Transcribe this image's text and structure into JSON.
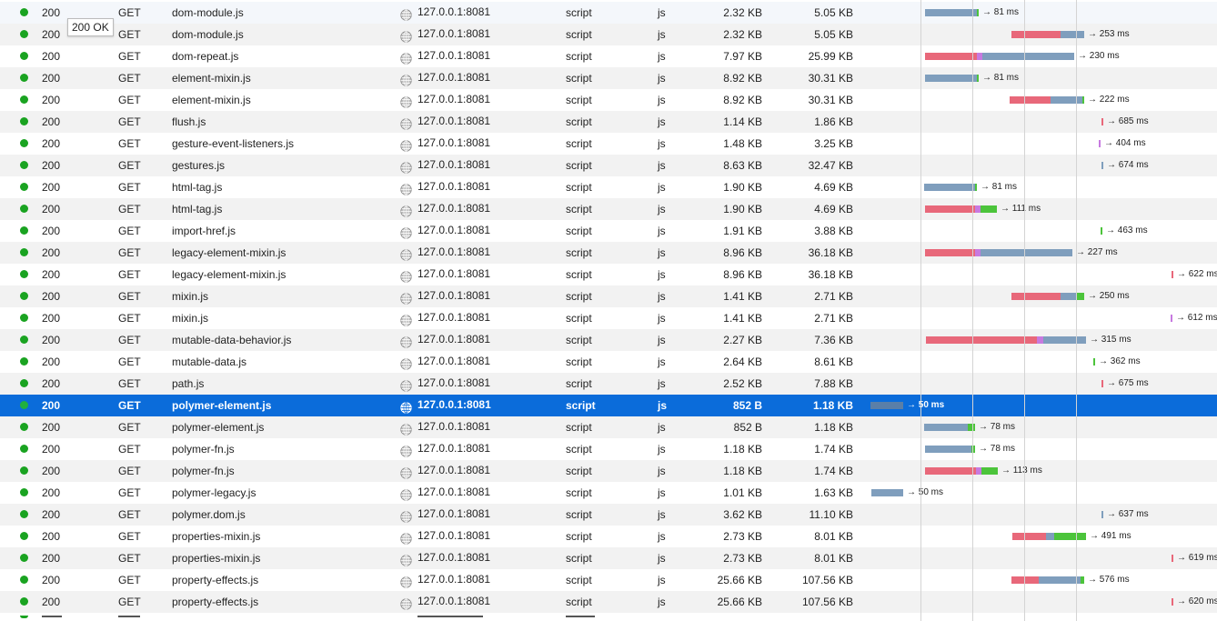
{
  "tooltip": "200 OK",
  "colors": {
    "blocked": "#e8687a",
    "dns": "#c77ae0",
    "wait": "#7f9ebd",
    "receive": "#4cc43b",
    "selected": "#0b6cda"
  },
  "rows": [
    {
      "status": "200",
      "method": "GET",
      "file": "dom-module.js",
      "domain": "127.0.0.1:8081",
      "type": "script",
      "ext": "js",
      "transferred": "2.32 KB",
      "size": "5.05 KB",
      "timing": "→ 81 ms",
      "segments": [
        {
          "s": 1017,
          "e": 1074,
          "c": "wait"
        },
        {
          "s": 1074,
          "e": 1076,
          "c": "receive"
        }
      ],
      "labelX": 1080
    },
    {
      "status": "200",
      "method": "GET",
      "file": "dom-module.js",
      "domain": "127.0.0.1:8081",
      "type": "script",
      "ext": "js",
      "transferred": "2.32 KB",
      "size": "5.05 KB",
      "timing": "→ 253 ms",
      "segments": [
        {
          "s": 1112,
          "e": 1166,
          "c": "blocked"
        },
        {
          "s": 1166,
          "e": 1192,
          "c": "wait"
        }
      ],
      "labelX": 1196
    },
    {
      "status": "200",
      "method": "GET",
      "file": "dom-repeat.js",
      "domain": "127.0.0.1:8081",
      "type": "script",
      "ext": "js",
      "transferred": "7.97 KB",
      "size": "25.99 KB",
      "timing": "→ 230 ms",
      "segments": [
        {
          "s": 1017,
          "e": 1074,
          "c": "blocked"
        },
        {
          "s": 1074,
          "e": 1080,
          "c": "dns"
        },
        {
          "s": 1080,
          "e": 1181,
          "c": "wait"
        }
      ],
      "labelX": 1185
    },
    {
      "status": "200",
      "method": "GET",
      "file": "element-mixin.js",
      "domain": "127.0.0.1:8081",
      "type": "script",
      "ext": "js",
      "transferred": "8.92 KB",
      "size": "30.31 KB",
      "timing": "→ 81 ms",
      "segments": [
        {
          "s": 1017,
          "e": 1074,
          "c": "wait"
        },
        {
          "s": 1074,
          "e": 1076,
          "c": "receive"
        }
      ],
      "labelX": 1080
    },
    {
      "status": "200",
      "method": "GET",
      "file": "element-mixin.js",
      "domain": "127.0.0.1:8081",
      "type": "script",
      "ext": "js",
      "transferred": "8.92 KB",
      "size": "30.31 KB",
      "timing": "→ 222 ms",
      "segments": [
        {
          "s": 1110,
          "e": 1155,
          "c": "blocked"
        },
        {
          "s": 1155,
          "e": 1190,
          "c": "wait"
        },
        {
          "s": 1190,
          "e": 1192,
          "c": "receive"
        }
      ],
      "labelX": 1196
    },
    {
      "status": "200",
      "method": "GET",
      "file": "flush.js",
      "domain": "127.0.0.1:8081",
      "type": "script",
      "ext": "js",
      "transferred": "1.14 KB",
      "size": "1.86 KB",
      "timing": "→ 685 ms",
      "segments": [
        {
          "s": 1211,
          "e": 1213,
          "c": "blocked"
        }
      ],
      "labelX": 1217
    },
    {
      "status": "200",
      "method": "GET",
      "file": "gesture-event-listeners.js",
      "domain": "127.0.0.1:8081",
      "type": "script",
      "ext": "js",
      "transferred": "1.48 KB",
      "size": "3.25 KB",
      "timing": "→ 404 ms",
      "segments": [
        {
          "s": 1208,
          "e": 1210,
          "c": "dns"
        }
      ],
      "labelX": 1214
    },
    {
      "status": "200",
      "method": "GET",
      "file": "gestures.js",
      "domain": "127.0.0.1:8081",
      "type": "script",
      "ext": "js",
      "transferred": "8.63 KB",
      "size": "32.47 KB",
      "timing": "→ 674 ms",
      "segments": [
        {
          "s": 1211,
          "e": 1213,
          "c": "wait"
        }
      ],
      "labelX": 1217
    },
    {
      "status": "200",
      "method": "GET",
      "file": "html-tag.js",
      "domain": "127.0.0.1:8081",
      "type": "script",
      "ext": "js",
      "transferred": "1.90 KB",
      "size": "4.69 KB",
      "timing": "→ 81 ms",
      "segments": [
        {
          "s": 1016,
          "e": 1072,
          "c": "wait"
        },
        {
          "s": 1072,
          "e": 1074,
          "c": "receive"
        }
      ],
      "labelX": 1078
    },
    {
      "status": "200",
      "method": "GET",
      "file": "html-tag.js",
      "domain": "127.0.0.1:8081",
      "type": "script",
      "ext": "js",
      "transferred": "1.90 KB",
      "size": "4.69 KB",
      "timing": "→ 111 ms",
      "segments": [
        {
          "s": 1017,
          "e": 1072,
          "c": "blocked"
        },
        {
          "s": 1072,
          "e": 1078,
          "c": "dns"
        },
        {
          "s": 1078,
          "e": 1096,
          "c": "receive"
        }
      ],
      "labelX": 1100
    },
    {
      "status": "200",
      "method": "GET",
      "file": "import-href.js",
      "domain": "127.0.0.1:8081",
      "type": "script",
      "ext": "js",
      "transferred": "1.91 KB",
      "size": "3.88 KB",
      "timing": "→ 463 ms",
      "segments": [
        {
          "s": 1210,
          "e": 1212,
          "c": "receive"
        }
      ],
      "labelX": 1216
    },
    {
      "status": "200",
      "method": "GET",
      "file": "legacy-element-mixin.js",
      "domain": "127.0.0.1:8081",
      "type": "script",
      "ext": "js",
      "transferred": "8.96 KB",
      "size": "36.18 KB",
      "timing": "→ 227 ms",
      "segments": [
        {
          "s": 1017,
          "e": 1072,
          "c": "blocked"
        },
        {
          "s": 1072,
          "e": 1078,
          "c": "dns"
        },
        {
          "s": 1078,
          "e": 1179,
          "c": "wait"
        }
      ],
      "labelX": 1183
    },
    {
      "status": "200",
      "method": "GET",
      "file": "legacy-element-mixin.js",
      "domain": "127.0.0.1:8081",
      "type": "script",
      "ext": "js",
      "transferred": "8.96 KB",
      "size": "36.18 KB",
      "timing": "→ 622 ms",
      "segments": [
        {
          "s": 1288,
          "e": 1290,
          "c": "blocked"
        }
      ],
      "labelX": 1294
    },
    {
      "status": "200",
      "method": "GET",
      "file": "mixin.js",
      "domain": "127.0.0.1:8081",
      "type": "script",
      "ext": "js",
      "transferred": "1.41 KB",
      "size": "2.71 KB",
      "timing": "→ 250 ms",
      "segments": [
        {
          "s": 1112,
          "e": 1166,
          "c": "blocked"
        },
        {
          "s": 1166,
          "e": 1183,
          "c": "wait"
        },
        {
          "s": 1183,
          "e": 1192,
          "c": "receive"
        }
      ],
      "labelX": 1196
    },
    {
      "status": "200",
      "method": "GET",
      "file": "mixin.js",
      "domain": "127.0.0.1:8081",
      "type": "script",
      "ext": "js",
      "transferred": "1.41 KB",
      "size": "2.71 KB",
      "timing": "→ 612 ms",
      "segments": [
        {
          "s": 1287,
          "e": 1289,
          "c": "dns"
        }
      ],
      "labelX": 1293
    },
    {
      "status": "200",
      "method": "GET",
      "file": "mutable-data-behavior.js",
      "domain": "127.0.0.1:8081",
      "type": "script",
      "ext": "js",
      "transferred": "2.27 KB",
      "size": "7.36 KB",
      "timing": "→ 315 ms",
      "segments": [
        {
          "s": 1018,
          "e": 1140,
          "c": "blocked"
        },
        {
          "s": 1140,
          "e": 1147,
          "c": "dns"
        },
        {
          "s": 1147,
          "e": 1194,
          "c": "wait"
        }
      ],
      "labelX": 1198
    },
    {
      "status": "200",
      "method": "GET",
      "file": "mutable-data.js",
      "domain": "127.0.0.1:8081",
      "type": "script",
      "ext": "js",
      "transferred": "2.64 KB",
      "size": "8.61 KB",
      "timing": "→ 362 ms",
      "segments": [
        {
          "s": 1202,
          "e": 1204,
          "c": "receive"
        }
      ],
      "labelX": 1208
    },
    {
      "status": "200",
      "method": "GET",
      "file": "path.js",
      "domain": "127.0.0.1:8081",
      "type": "script",
      "ext": "js",
      "transferred": "2.52 KB",
      "size": "7.88 KB",
      "timing": "→ 675 ms",
      "segments": [
        {
          "s": 1211,
          "e": 1213,
          "c": "blocked"
        }
      ],
      "labelX": 1217
    },
    {
      "status": "200",
      "method": "GET",
      "file": "polymer-element.js",
      "domain": "127.0.0.1:8081",
      "type": "script",
      "ext": "js",
      "transferred": "852 B",
      "size": "1.18 KB",
      "timing": "→ 50 ms",
      "segments": [
        {
          "s": 957,
          "e": 993,
          "c": "wait"
        }
      ],
      "labelX": 997,
      "selected": true
    },
    {
      "status": "200",
      "method": "GET",
      "file": "polymer-element.js",
      "domain": "127.0.0.1:8081",
      "type": "script",
      "ext": "js",
      "transferred": "852 B",
      "size": "1.18 KB",
      "timing": "→ 78 ms",
      "segments": [
        {
          "s": 1016,
          "e": 1064,
          "c": "wait"
        },
        {
          "s": 1064,
          "e": 1072,
          "c": "receive"
        }
      ],
      "labelX": 1076
    },
    {
      "status": "200",
      "method": "GET",
      "file": "polymer-fn.js",
      "domain": "127.0.0.1:8081",
      "type": "script",
      "ext": "js",
      "transferred": "1.18 KB",
      "size": "1.74 KB",
      "timing": "→ 78 ms",
      "segments": [
        {
          "s": 1017,
          "e": 1068,
          "c": "wait"
        },
        {
          "s": 1068,
          "e": 1072,
          "c": "receive"
        }
      ],
      "labelX": 1076
    },
    {
      "status": "200",
      "method": "GET",
      "file": "polymer-fn.js",
      "domain": "127.0.0.1:8081",
      "type": "script",
      "ext": "js",
      "transferred": "1.18 KB",
      "size": "1.74 KB",
      "timing": "→ 113 ms",
      "segments": [
        {
          "s": 1017,
          "e": 1073,
          "c": "blocked"
        },
        {
          "s": 1073,
          "e": 1079,
          "c": "dns"
        },
        {
          "s": 1079,
          "e": 1097,
          "c": "receive"
        }
      ],
      "labelX": 1101
    },
    {
      "status": "200",
      "method": "GET",
      "file": "polymer-legacy.js",
      "domain": "127.0.0.1:8081",
      "type": "script",
      "ext": "js",
      "transferred": "1.01 KB",
      "size": "1.63 KB",
      "timing": "→ 50 ms",
      "segments": [
        {
          "s": 958,
          "e": 993,
          "c": "wait"
        }
      ],
      "labelX": 997
    },
    {
      "status": "200",
      "method": "GET",
      "file": "polymer.dom.js",
      "domain": "127.0.0.1:8081",
      "type": "script",
      "ext": "js",
      "transferred": "3.62 KB",
      "size": "11.10 KB",
      "timing": "→ 637 ms",
      "segments": [
        {
          "s": 1211,
          "e": 1213,
          "c": "wait"
        }
      ],
      "labelX": 1217
    },
    {
      "status": "200",
      "method": "GET",
      "file": "properties-mixin.js",
      "domain": "127.0.0.1:8081",
      "type": "script",
      "ext": "js",
      "transferred": "2.73 KB",
      "size": "8.01 KB",
      "timing": "→ 491 ms",
      "segments": [
        {
          "s": 1113,
          "e": 1150,
          "c": "blocked"
        },
        {
          "s": 1150,
          "e": 1159,
          "c": "wait"
        },
        {
          "s": 1159,
          "e": 1194,
          "c": "receive"
        }
      ],
      "labelX": 1198
    },
    {
      "status": "200",
      "method": "GET",
      "file": "properties-mixin.js",
      "domain": "127.0.0.1:8081",
      "type": "script",
      "ext": "js",
      "transferred": "2.73 KB",
      "size": "8.01 KB",
      "timing": "→ 619 ms",
      "segments": [
        {
          "s": 1288,
          "e": 1290,
          "c": "blocked"
        }
      ],
      "labelX": 1294
    },
    {
      "status": "200",
      "method": "GET",
      "file": "property-effects.js",
      "domain": "127.0.0.1:8081",
      "type": "script",
      "ext": "js",
      "transferred": "25.66 KB",
      "size": "107.56 KB",
      "timing": "→ 576 ms",
      "segments": [
        {
          "s": 1112,
          "e": 1142,
          "c": "blocked"
        },
        {
          "s": 1142,
          "e": 1188,
          "c": "wait"
        },
        {
          "s": 1188,
          "e": 1192,
          "c": "receive"
        }
      ],
      "labelX": 1196
    },
    {
      "status": "200",
      "method": "GET",
      "file": "property-effects.js",
      "domain": "127.0.0.1:8081",
      "type": "script",
      "ext": "js",
      "transferred": "25.66 KB",
      "size": "107.56 KB",
      "timing": "→ 620 ms",
      "segments": [
        {
          "s": 1288,
          "e": 1290,
          "c": "blocked"
        }
      ],
      "labelX": 1294
    }
  ]
}
